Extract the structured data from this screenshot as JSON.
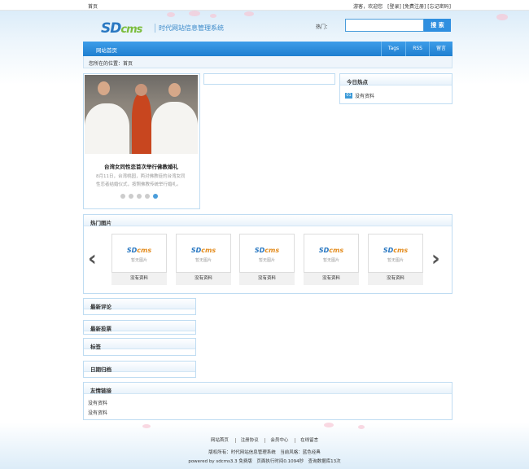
{
  "topbar": {
    "home": "首页",
    "user_links": "游客，欢迎您　[登录] [免费注册] [忘记密码]"
  },
  "header": {
    "logo_main": "SD",
    "logo_cms": "cms",
    "logo_sub": "时代网站信息管理系统",
    "hot_label": "热门：",
    "search_button": "搜 索",
    "search_value": ""
  },
  "nav": {
    "home": "网站首页",
    "right_items": [
      "Tags",
      "RSS",
      "留言"
    ]
  },
  "breadcrumb": "您所在的位置：首页",
  "slide": {
    "title": "台湾女同性恋首次举行佛教婚礼",
    "desc": "8月11日，台湾桃园，两对佛教徒的台湾女同性恋者结婚仪式，按照佛教传统举行婚礼。",
    "dot_count": 5,
    "active_dot": 4
  },
  "hot_today": {
    "title": "今日热点",
    "items": [
      {
        "num": "01",
        "text": "没有资料"
      }
    ]
  },
  "hot_pics": {
    "title": "热门图片",
    "prev": "‹",
    "next": "›",
    "items": [
      {
        "logo": "SD",
        "logo_c": "cms",
        "placeholder": "暂无图片",
        "caption": "没有资料"
      },
      {
        "logo": "SD",
        "logo_c": "cms",
        "placeholder": "暂无图片",
        "caption": "没有资料"
      },
      {
        "logo": "SD",
        "logo_c": "cms",
        "placeholder": "暂无图片",
        "caption": "没有资料"
      },
      {
        "logo": "SD",
        "logo_c": "cms",
        "placeholder": "暂无图片",
        "caption": "没有资料"
      },
      {
        "logo": "SD",
        "logo_c": "cms",
        "placeholder": "暂无图片",
        "caption": "没有资料"
      }
    ]
  },
  "sections": [
    "最新评论",
    "最新投票",
    "标签",
    "日期归档"
  ],
  "friend_links": {
    "title": "友情链接",
    "items": [
      "没有资料",
      "没有资料"
    ]
  },
  "footer": {
    "nav": [
      "网站首页",
      "注册协议",
      "会员中心",
      "在线留言"
    ],
    "copyright": "版权所有：时代网站信息管理系统　当前风格：蓝色经典",
    "powered": "powered by sdcms3.3 免费版　页面执行时间0.1094秒　查询数据库13次"
  }
}
